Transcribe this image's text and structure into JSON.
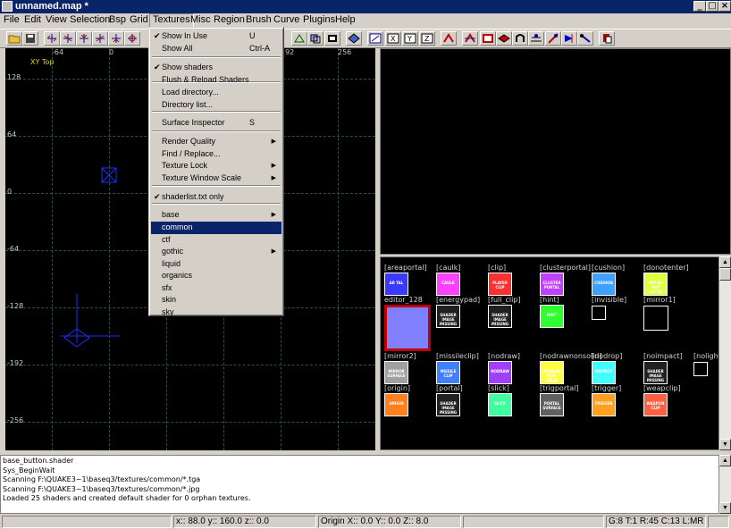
{
  "window": {
    "title": "unnamed.map *",
    "buttons": {
      "minimize": "_",
      "maximize": "□",
      "close": "×"
    }
  },
  "menubar": [
    "File",
    "Edit",
    "View",
    "Selection",
    "Bsp",
    "Grid",
    "Textures",
    "Misc",
    "Region",
    "Brush",
    "Curve",
    "Plugins",
    "Help"
  ],
  "textures_menu": {
    "items": [
      {
        "label": "Show In Use",
        "shortcut": "U",
        "checked": true
      },
      {
        "label": "Show All",
        "shortcut": "Ctrl-A"
      },
      {
        "label": "Show shaders",
        "checked": true
      },
      {
        "label": "Flush & Reload Shaders"
      },
      {
        "label": "Load directory..."
      },
      {
        "label": "Directory list..."
      },
      {
        "label": "Surface Inspector",
        "shortcut": "S"
      },
      {
        "label": "Render Quality",
        "submenu": true
      },
      {
        "label": "Find / Replace..."
      },
      {
        "label": "Texture Lock",
        "submenu": true
      },
      {
        "label": "Texture Window Scale",
        "submenu": true
      },
      {
        "label": "shaderlist.txt only",
        "checked": true
      },
      {
        "label": "base",
        "submenu": true
      },
      {
        "label": "common",
        "highlighted": true
      },
      {
        "label": "ctf"
      },
      {
        "label": "gothic",
        "submenu": true
      },
      {
        "label": "liquid"
      },
      {
        "label": "organics"
      },
      {
        "label": "sfx"
      },
      {
        "label": "skin"
      },
      {
        "label": "sky"
      }
    ]
  },
  "xy_view": {
    "label": "XY Top",
    "top_labels": [
      "-64",
      "0",
      "64",
      "128",
      "192",
      "256"
    ],
    "side_labels": [
      "128",
      "64",
      "0",
      "-64",
      "-128",
      "-192",
      "-256"
    ]
  },
  "textures": [
    {
      "name": "[areaportal]",
      "thumb": "AR TAL",
      "color": "#3a3aff"
    },
    {
      "name": "[caulk]",
      "thumb": "CAULK",
      "color": "#ff40ff"
    },
    {
      "name": "[clip]",
      "thumb": "PLAYER CLIP",
      "color": "#ff3030"
    },
    {
      "name": "[clusterportal]",
      "thumb": "CLUSTER PORTAL",
      "color": "#c040ff"
    },
    {
      "name": "[cushion]",
      "thumb": "CUSHION",
      "color": "#40a0ff"
    },
    {
      "name": "[donotenter]",
      "thumb": "NOT DO NOT ENTER",
      "color": "#e0ff40"
    },
    {
      "name": "editor_128",
      "thumb": "",
      "color": "#8080ff"
    },
    {
      "name": "[energypad]",
      "thumb": "SHADER IMAGE MISSING",
      "color": "#202020"
    },
    {
      "name": "[full_clip]",
      "thumb": "SHADER IMAGE MISSING",
      "color": "#202020"
    },
    {
      "name": "[hint]",
      "thumb": "HINT",
      "color": "#30ff30"
    },
    {
      "name": "[invisible]",
      "thumb": "",
      "color": "#000000"
    },
    {
      "name": "[mirror1]",
      "thumb": "",
      "color": "#000000"
    },
    {
      "name": "[mirror2]",
      "thumb": "MIRROR SURFACE",
      "color": "#a0a0a0"
    },
    {
      "name": "[missileclip]",
      "thumb": "MISSILE CLIP",
      "color": "#4080ff"
    },
    {
      "name": "[nodraw]",
      "thumb": "NODRAW",
      "color": "#a040ff"
    },
    {
      "name": "[nodrawnonsolid]",
      "thumb": "NODRAW NON-SOLID",
      "color": "#ffff40"
    },
    {
      "name": "[nodrop]",
      "thumb": "NODROP",
      "color": "#40ffff"
    },
    {
      "name": "[noimpact]",
      "thumb": "SHADER IMAGE MISSING",
      "color": "#202020"
    },
    {
      "name": "[nolight]",
      "thumb": "",
      "color": "#000000"
    },
    {
      "name": "[origin]",
      "thumb": "ORIGIN",
      "color": "#ff8020"
    },
    {
      "name": "[portal]",
      "thumb": "SHADER IMAGE MISSING",
      "color": "#202020"
    },
    {
      "name": "[slick]",
      "thumb": "SLICK",
      "color": "#40ffa0"
    },
    {
      "name": "[trigportal]",
      "thumb": "PORTAL SURFACE",
      "color": "#606060"
    },
    {
      "name": "[trigger]",
      "thumb": "TRIGGER",
      "color": "#ffa020"
    },
    {
      "name": "[weapclip]",
      "thumb": "WEAPON CLIP",
      "color": "#ff6040"
    }
  ],
  "console": [
    "base_button.shader",
    "Sys_BeginWait",
    "Scanning F:\\QUAKE3~1\\baseq3/textures/common/*.tga",
    "Scanning F:\\QUAKE3~1\\baseq3/textures/common/*.jpg",
    "Loaded 25 shaders and created default shader for 0 orphan textures."
  ],
  "status": {
    "coords": "x:: 88.0  y:: 160.0  z:: 0.0",
    "origin": "Origin X:: 0.0  Y:: 0.0  Z:: 8.0",
    "grid": "G:8 T:1 R:45 C:13 L:MR"
  },
  "colors": {
    "titlebar": "#0a246a",
    "highlight": "#0a246a",
    "selected_texture_border": "#c00000"
  }
}
